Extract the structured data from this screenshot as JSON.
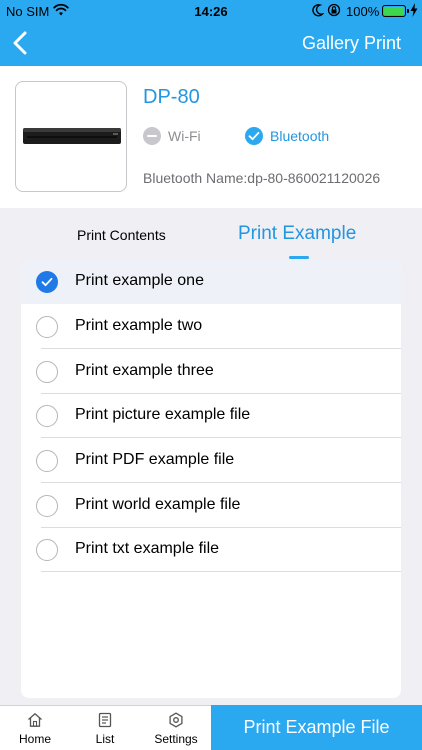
{
  "status_bar": {
    "carrier": "No SIM",
    "time": "14:26",
    "battery_percent": "100%",
    "wifi_icon": "wifi-icon",
    "moon_icon": "moon-icon",
    "lock_icon": "rotation-lock-icon",
    "battery_icon": "battery-full-icon",
    "charging_icon": "bolt-icon",
    "battery_color": "#3ed64c"
  },
  "header": {
    "title": "Gallery Print",
    "back_icon": "chevron-left-icon",
    "background": "#2aa9f0"
  },
  "device": {
    "name": "DP-80",
    "options": {
      "wifi_label": "Wi-Fi",
      "wifi_selected": false,
      "bluetooth_label": "Bluetooth",
      "bluetooth_selected": true
    },
    "bluetooth_name": "Bluetooth Name:dp-80-860021120026"
  },
  "tabs": [
    {
      "label": "Print Contents",
      "active": false
    },
    {
      "label": "Print Example",
      "active": true
    }
  ],
  "examples": [
    {
      "label": "Print example one",
      "selected": true
    },
    {
      "label": "Print example two",
      "selected": false
    },
    {
      "label": "Print example three",
      "selected": false
    },
    {
      "label": "Print picture example file",
      "selected": false
    },
    {
      "label": "Print PDF example file",
      "selected": false
    },
    {
      "label": "Print world example file",
      "selected": false
    },
    {
      "label": "Print txt example file",
      "selected": false
    }
  ],
  "tabbar": {
    "items": [
      {
        "label": "Home",
        "icon": "home-icon"
      },
      {
        "label": "List",
        "icon": "list-icon"
      },
      {
        "label": "Settings",
        "icon": "settings-icon"
      }
    ],
    "action_label": "Print Example File"
  },
  "colors": {
    "accent": "#2aa9f0",
    "link_text": "#2296e0",
    "radio_selected": "#1f7ae8"
  }
}
